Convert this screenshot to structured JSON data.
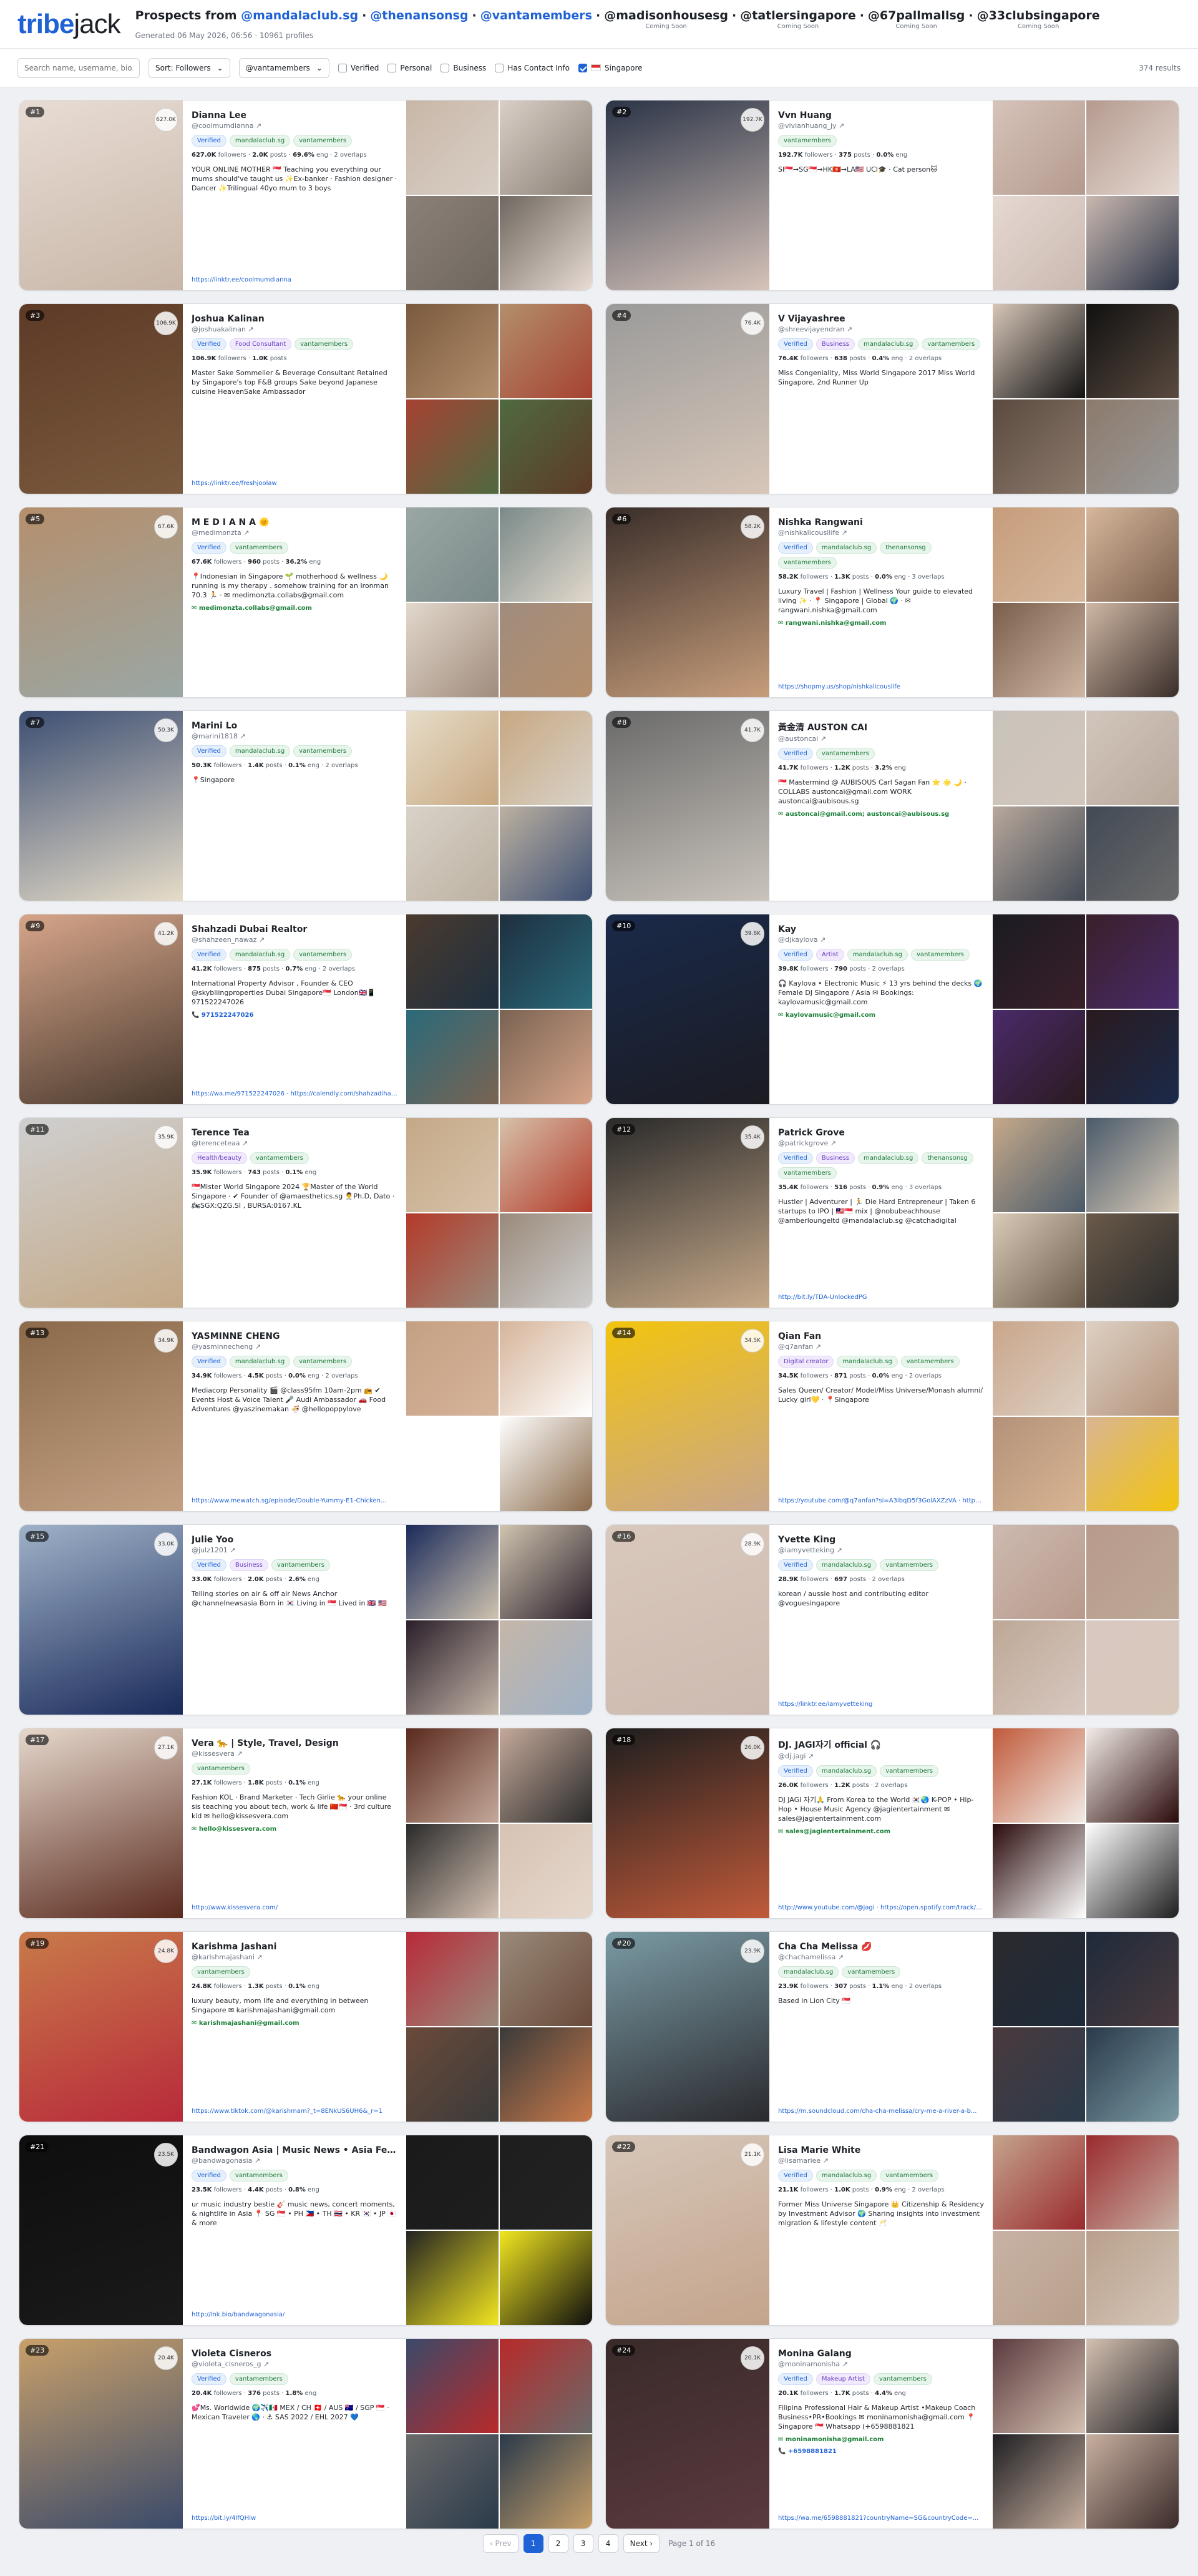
{
  "header": {
    "logo_part1": "tribe",
    "logo_part2": "jack",
    "prefix": "Prospects from",
    "accounts": [
      {
        "name": "@mandalaclub.sg",
        "soon": ""
      },
      {
        "name": "@thenansonsg",
        "soon": ""
      },
      {
        "name": "@vantamembers",
        "soon": ""
      },
      {
        "name": "@madisonhousesg",
        "soon": "Coming Soon"
      },
      {
        "name": "@tatlersingapore",
        "soon": "Coming Soon"
      },
      {
        "name": "@67pallmallsg",
        "soon": "Coming Soon"
      },
      {
        "name": "@33clubsingapore",
        "soon": "Coming Soon"
      }
    ],
    "subtitle": "Generated 06 May 2026, 06:56 · 10961 profiles"
  },
  "toolbar": {
    "search_placeholder": "Search name, username, bio...",
    "sort_label": "Sort: Followers",
    "club_label": "@vantamembers",
    "filters": [
      "Verified",
      "Personal",
      "Business",
      "Has Contact Info"
    ],
    "country_label": "Singapore",
    "results": "374 results"
  },
  "cards": [
    {
      "rank": "#1",
      "score": "627.0K",
      "name": "Dianna Lee",
      "handle": "@coolmumdianna ↗",
      "badges": [
        "Verified",
        "mandalaclub.sg",
        "vantamembers"
      ],
      "followers": "627.0K",
      "posts": "2.0K",
      "eng": "69.6%",
      "overlaps": "· 2 overlaps",
      "bio": "YOUR ONLINE MOTHER 🇸🇬 Teaching you everything our mums should've taught us ✨Ex-banker · Fashion designer · Dancer ✨Trilingual 40yo mum to 3 boys",
      "email": "",
      "phone": "",
      "link": "https://linktr.ee/coolmumdianna",
      "colors": [
        "#e8dcd4",
        "#c8b7a8",
        "#d9cfc6",
        "#8a8077",
        "#6f675f"
      ]
    },
    {
      "rank": "#2",
      "score": "192.7K",
      "name": "Vvn Huang",
      "handle": "@vivianhuang_jy ↗",
      "badges": [
        "vantamembers"
      ],
      "followers": "192.7K",
      "posts": "375",
      "eng": "0.0%",
      "overlaps": "",
      "bio": "SI🇸🇬→SG🇸🇬→HK🇭🇰→LA🇺🇸 UCI🎓 · Cat person🐱",
      "email": "",
      "phone": "",
      "link": "",
      "colors": [
        "#2b3447",
        "#d6c3b9",
        "#b49a8f",
        "#e6d9d2",
        "#c9b8b0"
      ]
    },
    {
      "rank": "#3",
      "score": "106.9K",
      "name": "Joshua Kalinan",
      "handle": "@joshuakalinan ↗",
      "badges": [
        "Verified",
        "Food Consultant",
        "vantamembers"
      ],
      "followers": "106.9K",
      "posts": "1.0K",
      "eng": "",
      "overlaps": "",
      "bio": "Master Sake Sommelier & Beverage Consultant Retained by Singapore's top F&B groups Sake beyond Japanese cuisine HeavenSake Ambassador",
      "email": "",
      "phone": "",
      "link": "https://linktr.ee/freshjoolaw",
      "colors": [
        "#5d3a26",
        "#7a5a3e",
        "#b38f6c",
        "#a64232",
        "#4f6a41"
      ]
    },
    {
      "rank": "#4",
      "score": "76.4K",
      "name": "V Vijayashree",
      "handle": "@shreevijayendran ↗",
      "badges": [
        "Verified",
        "Business",
        "mandalaclub.sg",
        "vantamembers"
      ],
      "followers": "76.4K",
      "posts": "638",
      "eng": "0.4%",
      "overlaps": "· 2 overlaps",
      "bio": "Miss Congeniality, Miss World Singapore 2017 Miss World Singapore, 2nd Runner Up",
      "email": "",
      "phone": "",
      "link": "",
      "colors": [
        "#9a9a9a",
        "#d7c6b8",
        "#111111",
        "#5a4a3f",
        "#8c7a6c"
      ]
    },
    {
      "rank": "#5",
      "score": "67.6K",
      "name": "M E D I A N A 🌞",
      "handle": "@medimonzta ↗",
      "badges": [
        "Verified",
        "vantamembers"
      ],
      "followers": "67.6K",
      "posts": "960",
      "eng": "36.2%",
      "overlaps": "",
      "bio": "📍Indonesian in Singapore 🌱 motherhood & wellness 🌙 running is my therapy . somehow training for an Ironman 70.3 🏃 · ✉ medimonzta.collabs@gmail.com",
      "email": "✉ medimonzta.collabs@gmail.com",
      "phone": "",
      "link": "",
      "colors": [
        "#b58f6d",
        "#9aa7a4",
        "#7a8a89",
        "#e2d8cc",
        "#a08c7d"
      ]
    },
    {
      "rank": "#6",
      "score": "58.2K",
      "name": "Nishka Rangwani",
      "handle": "@nishkalicousllife ↗",
      "badges": [
        "Verified",
        "mandalaclub.sg",
        "thenansonsg",
        "vantamembers"
      ],
      "followers": "58.2K",
      "posts": "1.3K",
      "eng": "0.0%",
      "overlaps": "· 3 overlaps",
      "bio": "Luxury Travel | Fashion | Wellness Your guide to elevated living ✨ · 📍 Singapore | Global 🌍 · ✉ rangwani.nishka@gmail.com",
      "email": "✉ rangwani.nishka@gmail.com",
      "phone": "",
      "link": "https://shopmy.us/shop/nishkalicouslife",
      "colors": [
        "#3a2e2a",
        "#c69d7b",
        "#d6b79c",
        "#7a5e4c",
        "#cfb7a4"
      ]
    },
    {
      "rank": "#7",
      "score": "50.3K",
      "name": "Marini Lo",
      "handle": "@marini1818 ↗",
      "badges": [
        "Verified",
        "mandalaclub.sg",
        "vantamembers"
      ],
      "followers": "50.3K",
      "posts": "1.4K",
      "eng": "0.1%",
      "overlaps": "· 2 overlaps",
      "bio": "📍Singapore",
      "email": "",
      "phone": "",
      "link": "",
      "colors": [
        "#3d4f73",
        "#e6dcc8",
        "#c8a882",
        "#d8d2c8",
        "#bcb1a1"
      ]
    },
    {
      "rank": "#8",
      "score": "41.7K",
      "name": "黃金清 AUSTON CAI",
      "handle": "@austoncai ↗",
      "badges": [
        "Verified",
        "vantamembers"
      ],
      "followers": "41.7K",
      "posts": "1.2K",
      "eng": "3.2%",
      "overlaps": "",
      "bio": "🇸🇬 Mastermind @ AUBISOUS Carl Sagan Fan ⭐ 🌟 🌙 · COLLABS austoncai@gmail.com WORK austoncai@aubisous.sg",
      "email": "✉ austoncai@gmail.com; austoncai@aubisous.sg",
      "phone": "",
      "link": "",
      "colors": [
        "#6a6a6a",
        "#c9c3bb",
        "#d2c6bc",
        "#b8a89c",
        "#424a55"
      ]
    },
    {
      "rank": "#9",
      "score": "41.2K",
      "name": "Shahzadi Dubai Realtor",
      "handle": "@shahzeen_nawaz ↗",
      "badges": [
        "Verified",
        "mandalaclub.sg",
        "vantamembers"
      ],
      "followers": "41.2K",
      "posts": "875",
      "eng": "0.7%",
      "overlaps": "· 2 overlaps",
      "bio": "International Property Advisor , Founder & CEO @skybliingproperties Dubai Singapore🇸🇬 London🇬🇧📱 971522247026",
      "email": "",
      "phone": "📞 971522247026",
      "link": "https://wa.me/971522247026 · https://calendly.com/shahzadihanji/30min · https://wa.me/971522247026?countryName=AE&countryCod...",
      "colors": [
        "#d6a58a",
        "#4a3a2e",
        "#1e2f3f",
        "#2a6a7a",
        "#7a6352"
      ]
    },
    {
      "rank": "#10",
      "score": "39.8K",
      "name": "Kay",
      "handle": "@djkaylova ↗",
      "badges": [
        "Verified",
        "Artist",
        "mandalaclub.sg",
        "vantamembers"
      ],
      "followers": "39.8K",
      "posts": "790",
      "eng": "",
      "overlaps": "· 2 overlaps",
      "bio": "🎧 Kaylova • Electronic Music ⚡ 13 yrs behind the decks 🌍 Female DJ Singapore / Asia ✉ Bookings: kaylovamusic@gmail.com",
      "email": "✉ kaylovamusic@gmail.com",
      "phone": "",
      "link": "",
      "colors": [
        "#1a2a4a",
        "#1b1b22",
        "#3a1f2a",
        "#4a2a6a",
        "#2a1a1e"
      ]
    },
    {
      "rank": "#11",
      "score": "35.9K",
      "name": "Terence Tea",
      "handle": "@terenceteaa ↗",
      "badges": [
        "Health/beauty",
        "vantamembers"
      ],
      "followers": "35.9K",
      "posts": "743",
      "eng": "0.1%",
      "overlaps": "",
      "bio": "🇸🇬Mister World Singapore 2024 🏆Master of the World Singapore · ✔ Founder of @amaesthetics.sg 👨‍⚕️Ph.D, Dato · 🏍SGX:QZG.SI , BURSA:0167.KL",
      "email": "",
      "phone": "",
      "link": "",
      "colors": [
        "#cfcfcf",
        "#c4a987",
        "#d6c1a9",
        "#b33a2a",
        "#9a8a7a"
      ]
    },
    {
      "rank": "#12",
      "score": "35.4K",
      "name": "Patrick Grove",
      "handle": "@patrickgrove ↗",
      "badges": [
        "Verified",
        "Business",
        "mandalaclub.sg",
        "thenansonsg",
        "vantamembers"
      ],
      "followers": "35.4K",
      "posts": "516",
      "eng": "0.9%",
      "overlaps": "· 3 overlaps",
      "bio": "Hustler | Adventurer | 🏃 Die Hard Entrepreneur | Taken 6 startups to IPO | 🇲🇾🇸🇬 mix | @nobubeachhouse @amberloungeltd @mandalaclub.sg @catchadigital",
      "email": "",
      "phone": "",
      "link": "http://bit.ly/TDA-UnlockedPG",
      "colors": [
        "#2a2a2a",
        "#c6a98a",
        "#4a5a6a",
        "#d9cbb8",
        "#6a5a4a"
      ]
    },
    {
      "rank": "#13",
      "score": "34.9K",
      "name": "YASMINNE CHENG",
      "handle": "@yasminnecheng ↗",
      "badges": [
        "Verified",
        "mandalaclub.sg",
        "vantamembers"
      ],
      "followers": "34.9K",
      "posts": "4.5K",
      "eng": "0.0%",
      "overlaps": "· 2 overlaps",
      "bio": "Mediacorp Personality 🎬 @class95fm 10am-2pm 📻 ✔ Events Host & Voice Talent 🎤 Audi Ambassador 🚗 Food Adventures @yaszinemakan 🍜 @hellopoppylove",
      "email": "",
      "phone": "",
      "link": "https://www.mewatch.sg/episode/Double-Yummy-E1-Chicken...",
      "colors": [
        "#8a6a4a",
        "#c4a083",
        "#d6b49a",
        "#ffffff",
        "#ffffff"
      ]
    },
    {
      "rank": "#14",
      "score": "34.5K",
      "name": "Qian Fan",
      "handle": "@q7anfan ↗",
      "badges": [
        "Digital creator",
        "mandalaclub.sg",
        "vantamembers"
      ],
      "followers": "34.5K",
      "posts": "871",
      "eng": "0.0%",
      "overlaps": "· 2 overlaps",
      "bio": "Sales Queen/ Creator/ Model/Miss Universe/Monash alumni/ Lucky girl💛 · 📍Singapore",
      "email": "",
      "phone": "",
      "link": "https://youtube.com/@q7anfan?si=A3ibqD5f3GolAXZzVA · https://www.tiktok.com/@q7anfan?_t=ZS-8vznkKCXjabIh&_r=1 · https://lust.li/cnmeia",
      "colors": [
        "#f2c40e",
        "#c9a68b",
        "#ddd0c3",
        "#b3927a",
        "#d9b592"
      ]
    },
    {
      "rank": "#15",
      "score": "33.0K",
      "name": "Julie Yoo",
      "handle": "@julz1201 ↗",
      "badges": [
        "Verified",
        "Business",
        "vantamembers"
      ],
      "followers": "33.0K",
      "posts": "2.0K",
      "eng": "2.6%",
      "overlaps": "",
      "bio": "Telling stories on air & off air News Anchor @channelnewsasia Born in 🇰🇷 Living in 🇸🇬 Lived in 🇬🇧 🇺🇸",
      "email": "",
      "phone": "",
      "link": "",
      "colors": [
        "#9fb2c8",
        "#1a2a5a",
        "#d0c4b0",
        "#2a1f2a",
        "#c5b6a8"
      ]
    },
    {
      "rank": "#16",
      "score": "28.9K",
      "name": "Yvette King",
      "handle": "@iamyvetteking ↗",
      "badges": [
        "Verified",
        "mandalaclub.sg",
        "vantamembers"
      ],
      "followers": "28.9K",
      "posts": "697",
      "eng": "",
      "overlaps": "· 2 overlaps",
      "bio": "korean / aussie host and contributing editor @voguesingapore",
      "email": "",
      "phone": "",
      "link": "https://linktr.ee/iamyvetteking",
      "colors": [
        "#d9c8bc",
        "#cdbab0",
        "#b89a8c",
        "#bda896",
        "#d8c8c0"
      ]
    },
    {
      "rank": "#17",
      "score": "27.1K",
      "name": "Vera 🐆 | Style, Travel, Design",
      "handle": "@kissesvera ↗",
      "badges": [
        "vantamembers"
      ],
      "followers": "27.1K",
      "posts": "1.8K",
      "eng": "0.1%",
      "overlaps": "",
      "bio": "Fashion KOL · Brand Marketer · Tech Girlie 🐆 your online sis teaching you about tech, work & life 🇨🇳🇸🇬 · 3rd culture kid ✉ hello@kissesvera.com",
      "email": "✉ hello@kissesvera.com",
      "phone": "",
      "link": "http://www.kissesvera.com/",
      "colors": [
        "#e6d8cc",
        "#5a2a1e",
        "#c4a99a",
        "#2a2a2a",
        "#d6c3b4"
      ]
    },
    {
      "rank": "#18",
      "score": "26.0K",
      "name": "DJ. JAGI자기 official 🎧",
      "handle": "@dj.jagi ↗",
      "badges": [
        "Verified",
        "mandalaclub.sg",
        "vantamembers"
      ],
      "followers": "26.0K",
      "posts": "1.2K",
      "eng": "",
      "overlaps": "· 2 overlaps",
      "bio": "DJ JAGI 자기🙏 From Korea to the World 🇰🇷🌏 K-POP • Hip-Hop • House Music Agency @jagientertainment ✉ sales@jagientertainment.com",
      "email": "✉ sales@jagientertainment.com",
      "phone": "",
      "link": "http://www.youtube.com/@jagi · https://open.spotify.com/track/6XI3VhmT5NdKD8E1HZV6Z?s... · https://music.apple.com/sg/song/bird-kill-my-vibe/1891003869",
      "colors": [
        "#1e1e1e",
        "#c05a3a",
        "#f2ece6",
        "#2a0a0a",
        "#ffffff"
      ]
    },
    {
      "rank": "#19",
      "score": "24.8K",
      "name": "Karishma Jashani",
      "handle": "@karishmajashani ↗",
      "badges": [
        "vantamembers"
      ],
      "followers": "24.8K",
      "posts": "1.3K",
      "eng": "0.1%",
      "overlaps": "",
      "bio": "luxury beauty, mom life and everything in between Singapore ✉ karishmajashani@gmail.com",
      "email": "✉ karishmajashani@gmail.com",
      "phone": "",
      "link": "https://www.tiktok.com/@karishmam?_t=8ENkUS6UH6&_r=1",
      "colors": [
        "#c87a4a",
        "#b82a3a",
        "#9a8a7a",
        "#6a4a3a",
        "#3a3a3a"
      ]
    },
    {
      "rank": "#20",
      "score": "23.9K",
      "name": "Cha Cha Melissa 💋",
      "handle": "@chachamelissa ↗",
      "badges": [
        "mandalaclub.sg",
        "vantamembers"
      ],
      "followers": "23.9K",
      "posts": "307",
      "eng": "1.1%",
      "overlaps": "· 2 overlaps",
      "bio": "Based in Lion City 🇸🇬",
      "email": "",
      "phone": "",
      "link": "https://m.soundcloud.com/cha-cha-melissa/cry-me-a-river-a-b...",
      "colors": [
        "#7a9aa4",
        "#2a2a2e",
        "#1e2a3a",
        "#4a3a3e",
        "#2a3a4a"
      ]
    },
    {
      "rank": "#21",
      "score": "23.5K",
      "name": "Bandwagon Asia | Music News • Asia Festival...",
      "handle": "@bandwagonasia ↗",
      "badges": [
        "Verified",
        "vantamembers"
      ],
      "followers": "23.5K",
      "posts": "4.4K",
      "eng": "0.8%",
      "overlaps": "",
      "bio": "ur music industry bestie 🎸 music news, concert moments, & nightlife in Asia 📍 SG 🇸🇬 • PH 🇵🇭 • TH 🇹🇭 • KR 🇰🇷 • JP 🇯🇵 & more",
      "email": "",
      "phone": "",
      "link": "http://lnk.bio/bandwagonasia/",
      "colors": [
        "#0e0e0e",
        "#1a1a1a",
        "#1e1e1e",
        "#222222",
        "#f2e620"
      ]
    },
    {
      "rank": "#22",
      "score": "21.1K",
      "name": "Lisa Marie White",
      "handle": "@lisamariee ↗",
      "badges": [
        "Verified",
        "mandalaclub.sg",
        "vantamembers"
      ],
      "followers": "21.1K",
      "posts": "1.0K",
      "eng": "0.9%",
      "overlaps": "· 2 overlaps",
      "bio": "Former Miss Universe Singapore 👑 Citizenship & Residency by Investment Advisor 🌍 Sharing insights into investment migration & lifestyle content 🥂",
      "email": "",
      "phone": "",
      "link": "",
      "colors": [
        "#d6c6b8",
        "#c4a48c",
        "#9a2a2e",
        "#c8b2a4",
        "#b8a08c"
      ]
    },
    {
      "rank": "#23",
      "score": "20.4K",
      "name": "Violeta Cisneros",
      "handle": "@violeta_cisneros_g ↗",
      "badges": [
        "Verified",
        "vantamembers"
      ],
      "followers": "20.4K",
      "posts": "376",
      "eng": "1.8%",
      "overlaps": "",
      "bio": "💕Ms. Worldwide 🌍✈️🇲🇽 MEX / CH 🇨🇭 / AUS 🇦🇺 / SGP 🇸🇬 · Mexican Traveler 🌎 · ⚓ SAS 2022 / EHL 2027 💙",
      "email": "",
      "phone": "",
      "link": "https://bit.ly/4lfQHlw",
      "colors": [
        "#c8a06a",
        "#3a4a6a",
        "#b82a2a",
        "#6a6a6a",
        "#2a3a4a"
      ]
    },
    {
      "rank": "#24",
      "score": "20.1K",
      "name": "Monina Galang",
      "handle": "@moninamonisha ↗",
      "badges": [
        "Verified",
        "Makeup Artist",
        "vantamembers"
      ],
      "followers": "20.1K",
      "posts": "1.7K",
      "eng": "4.4%",
      "overlaps": "",
      "bio": "Filipina Professional Hair & Makeup Artist •Makeup Coach Business•PR•Bookings ✉ moninamonisha@gmail.com 📍Singapore 🇸🇬 Whatsapp (+6598881821",
      "email": "✉ moninamonisha@gmail.com",
      "phone": "📞 +6598881821",
      "link": "https://wa.me/6598881821?countryName=SG&countryCode=...",
      "colors": [
        "#3a2a2a",
        "#5a3a3e",
        "#d4c0b0",
        "#1e1e22",
        "#c8b0a0"
      ]
    }
  ],
  "pagination": {
    "prev": "‹ Prev",
    "pages": [
      "1",
      "2",
      "3",
      "4"
    ],
    "next": "Next ›",
    "info": "Page 1 of 16"
  }
}
